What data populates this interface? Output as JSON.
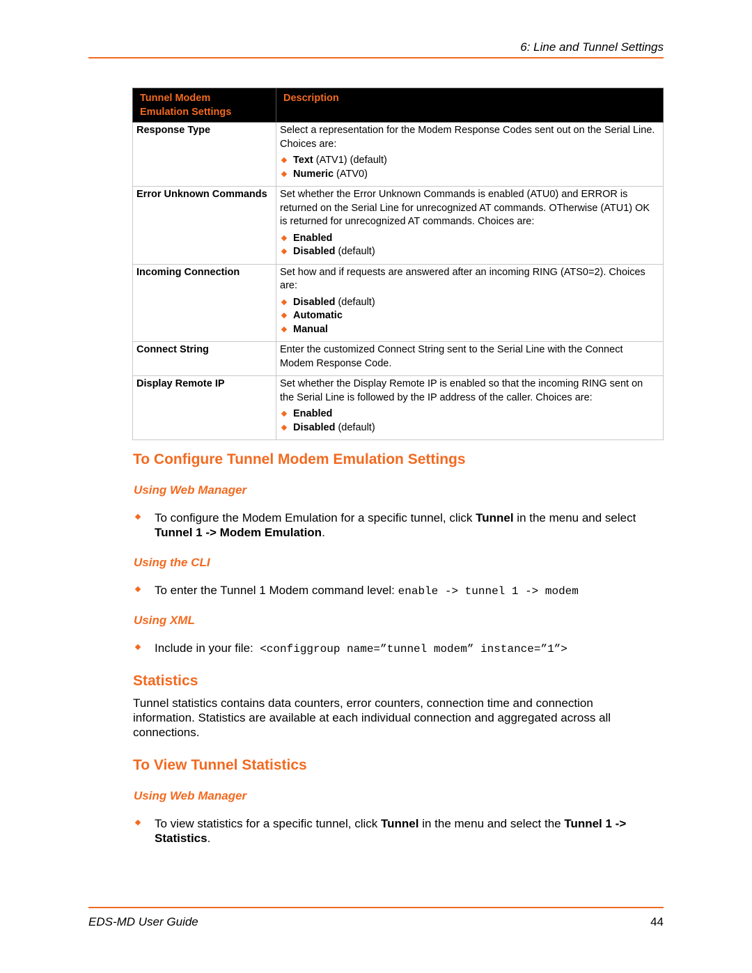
{
  "header": {
    "chapter": "6: Line and Tunnel Settings"
  },
  "table": {
    "headers": [
      "Tunnel Modem Emulation Settings",
      "Description"
    ],
    "header_line1": "Tunnel Modem",
    "header_line2": "Emulation Settings",
    "rows": [
      {
        "name": "Response Type",
        "description": "Select a representation for the Modem Response Codes sent out on the Serial Line.  Choices are:",
        "choices": [
          {
            "bold": "Text",
            "rest": " (ATV1) (default)"
          },
          {
            "bold": "Numeric",
            "rest": " (ATV0)"
          }
        ]
      },
      {
        "name": "Error Unknown Commands",
        "description": "Set whether the Error Unknown Commands is enabled (ATU0) and ERROR is returned on the Serial Line for unrecognized AT commands.  OTherwise (ATU1) OK is returned for unrecognized AT commands.  Choices are:",
        "choices": [
          {
            "bold": "Enabled",
            "rest": ""
          },
          {
            "bold": "Disabled",
            "rest": " (default)"
          }
        ]
      },
      {
        "name": "Incoming Connection",
        "description": "Set how and if requests are answered after an incoming RING (ATS0=2). Choices are:",
        "choices": [
          {
            "bold": "Disabled",
            "rest": " (default)"
          },
          {
            "bold": "Automatic",
            "rest": ""
          },
          {
            "bold": "Manual",
            "rest": ""
          }
        ]
      },
      {
        "name": "Connect String",
        "description": "Enter the customized Connect String sent to the Serial Line with the Connect Modem Response Code.",
        "choices": []
      },
      {
        "name": "Display Remote IP",
        "description": "Set whether the Display Remote IP is enabled so that the incoming RING sent on the Serial Line is followed by the IP address of the caller.  Choices are:",
        "choices": [
          {
            "bold": "Enabled",
            "rest": ""
          },
          {
            "bold": "Disabled",
            "rest": " (default)"
          }
        ]
      }
    ]
  },
  "configure_section": {
    "title": "To Configure Tunnel Modem Emulation Settings",
    "web_manager": {
      "heading": "Using Web Manager",
      "text_1": "To configure the Modem Emulation for a specific tunnel, click ",
      "bold_1": "Tunnel",
      "text_2": " in the menu and select ",
      "bold_2": "Tunnel 1 -> Modem Emulation",
      "text_3": "."
    },
    "cli": {
      "heading": "Using the CLI",
      "text": "To enter the Tunnel 1 Modem command level: ",
      "command": "enable -> tunnel 1 -> modem"
    },
    "xml": {
      "heading": "Using XML",
      "text": "Include in your file:  ",
      "code": "<configgroup name=”tunnel modem” instance=”1”>"
    }
  },
  "statistics_section": {
    "title": "Statistics",
    "body": "Tunnel statistics contains data counters, error counters, connection time and connection information.  Statistics are available at each individual connection and aggregated across all connections."
  },
  "view_stats_section": {
    "title": "To View Tunnel Statistics",
    "web_manager": {
      "heading": "Using Web Manager",
      "text_1": "To view statistics for a specific tunnel, click ",
      "bold_1": "Tunnel",
      "text_2": " in the menu and select the ",
      "bold_2": "Tunnel 1 -> Statistics",
      "text_3": "."
    }
  },
  "footer": {
    "guide_title": "EDS-MD User Guide",
    "page_number": "44"
  },
  "colors": {
    "accent": "#f26a21",
    "table_header_bg": "#000000"
  }
}
